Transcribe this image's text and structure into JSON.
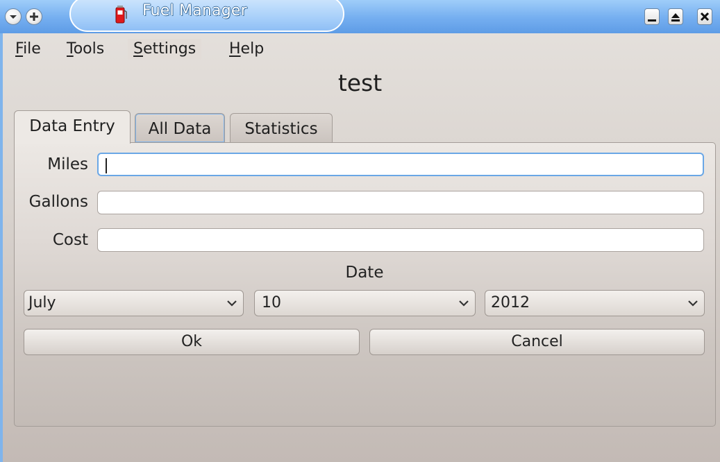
{
  "window": {
    "title": "Fuel Manager",
    "controls": [
      "minimize",
      "maximize",
      "close"
    ]
  },
  "menu": {
    "file": {
      "mnemonic": "F",
      "rest": "ile"
    },
    "tools": {
      "mnemonic": "T",
      "rest": "ools"
    },
    "settings": {
      "mnemonic": "S",
      "rest": "ettings"
    },
    "help": {
      "mnemonic": "H",
      "rest": "elp"
    }
  },
  "document_title": "test",
  "tabs": [
    {
      "label": "Data Entry",
      "active": true
    },
    {
      "label": "All Data",
      "active": false
    },
    {
      "label": "Statistics",
      "active": false
    }
  ],
  "form": {
    "miles": {
      "label": "Miles",
      "value": ""
    },
    "gallons": {
      "label": "Gallons",
      "value": ""
    },
    "cost": {
      "label": "Cost",
      "value": ""
    },
    "date_label": "Date",
    "month": "July",
    "day": "10",
    "year": "2012"
  },
  "buttons": {
    "ok": "Ok",
    "cancel": "Cancel"
  },
  "colors": {
    "titlebar": "#74aef0",
    "focus": "#6aa7e6",
    "panel": "#dfd9d5"
  },
  "icons": [
    "window-menu-icon",
    "sticky-icon",
    "fuel-pump-icon",
    "minimize-icon",
    "maximize-icon",
    "close-icon",
    "chevron-down-icon"
  ]
}
